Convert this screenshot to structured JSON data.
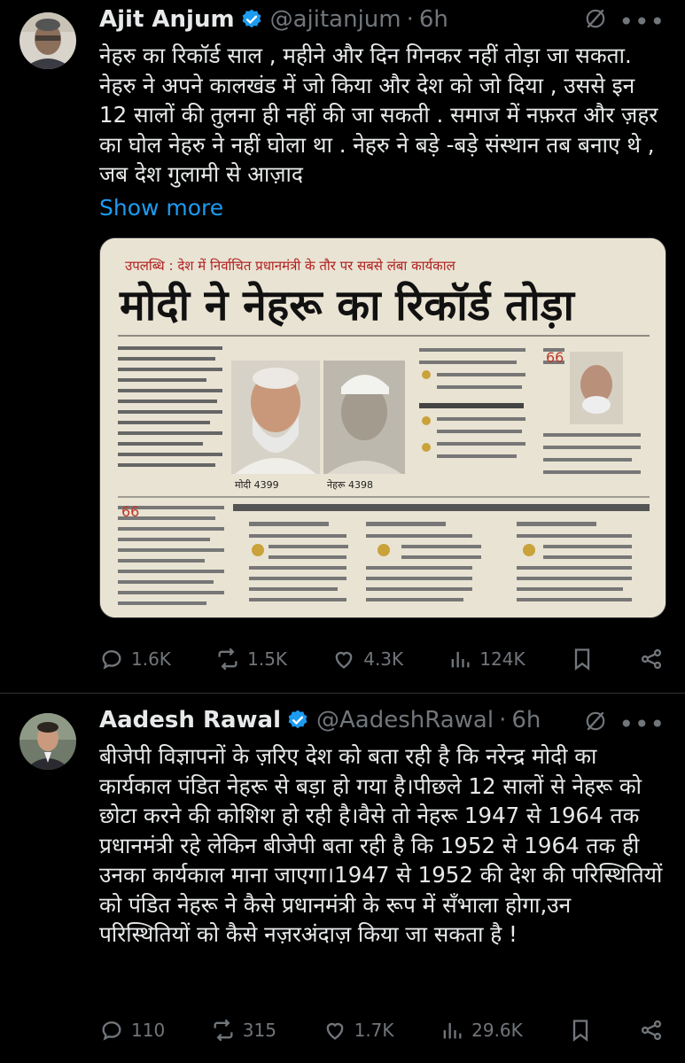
{
  "colors": {
    "background": "#000000",
    "text": "#e7e9ea",
    "muted": "#71767b",
    "link": "#1d9bf0",
    "verified": "#1d9bf0"
  },
  "tweets": [
    {
      "name": "Ajit Anjum",
      "handle": "@ajitanjum",
      "separator": "·",
      "time": "6h",
      "text": "नेहरु का रिकॉर्ड साल , महीने और दिन गिनकर नहीं तोड़ा जा सकता. नेहरु ने अपने कालखंड में जो किया और देश को जो दिया , उससे इन 12 सालों की तुलना ही नहीं की जा सकती . समाज में नफ़रत और ज़हर का घोल नेहरु ने नहीं घोला था . नेहरु ने बड़े -बड़े संस्थान तब बनाए थे , जब देश गुलामी से आज़ाद",
      "show_more": "Show more",
      "media": {
        "kicker": "उपलब्धि : देश में निर्वाचित प्रधानमंत्री के तौर पर सबसे लंबा कार्यकाल",
        "headline": "मोदी ने नेहरू का रिकॉर्ड तोड़ा",
        "caption_left": "मोदी 4399",
        "caption_right": "नेहरू 4398"
      },
      "stats": {
        "replies": "1.6K",
        "reposts": "1.5K",
        "likes": "4.3K",
        "views": "124K"
      }
    },
    {
      "name": "Aadesh Rawal",
      "handle": "@AadeshRawal",
      "separator": "·",
      "time": "6h",
      "text": "बीजेपी विज्ञापनों के ज़रिए देश को बता रही है कि नरेन्द्र मोदी का कार्यकाल पंडित नेहरू से बड़ा हो गया है।पीछले 12 सालों से नेहरू को छोटा करने की कोशिश हो रही है।वैसे तो नेहरू 1947 से 1964 तक प्रधानमंत्री रहे लेकिन बीजेपी बता रही है कि 1952 से 1964 तक ही उनका कार्यकाल माना जाएगा।1947 से 1952 की देश की परिस्थितियों को पंडित नेहरू ने कैसे प्रधानमंत्री के रूप में सँभाला होगा,उन परिस्थितियों को कैसे नज़रअंदाज़ किया जा सकता है !",
      "stats": {
        "replies": "110",
        "reposts": "315",
        "likes": "1.7K",
        "views": "29.6K"
      }
    }
  ],
  "icons": [
    "verified-badge-icon",
    "grok-icon",
    "more-icon",
    "reply-icon",
    "repost-icon",
    "like-icon",
    "views-icon",
    "bookmark-icon",
    "share-icon"
  ]
}
